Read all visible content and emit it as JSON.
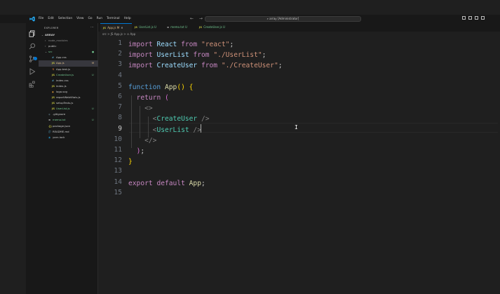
{
  "titlebar": {
    "menu": [
      "File",
      "Edit",
      "Selection",
      "View",
      "Go",
      "Run",
      "Terminal",
      "Help"
    ],
    "nav": "← →",
    "search": "⌕ array [Administrator]"
  },
  "activity": {
    "icons": [
      "explorer-icon",
      "search-icon",
      "source-control-icon",
      "run-debug-icon",
      "extensions-icon"
    ]
  },
  "sidebar": {
    "title": "EXPLORER",
    "more": "···",
    "items": [
      {
        "label": "ARRAY",
        "indent": 0,
        "chev": "⌄",
        "icon": "",
        "color": "#cccccc",
        "mark": "",
        "bold": true
      },
      {
        "label": "node_modules",
        "indent": 1,
        "chev": "›",
        "icon": "",
        "color": "#8b8b8b",
        "mark": ""
      },
      {
        "label": "public",
        "indent": 1,
        "chev": "›",
        "icon": "",
        "color": "#cccccc",
        "mark": ""
      },
      {
        "label": "src",
        "indent": 1,
        "chev": "⌄",
        "icon": "",
        "color": "#73c991",
        "mark": "●"
      },
      {
        "label": "App.css",
        "indent": 2,
        "chev": "",
        "icon": "#",
        "iconColor": "#519aba",
        "color": "#cccccc",
        "mark": ""
      },
      {
        "label": "App.js",
        "indent": 2,
        "chev": "",
        "icon": "JS",
        "iconColor": "#cbcb41",
        "color": "#e2c08d",
        "mark": "M",
        "active": true
      },
      {
        "label": "App.test.js",
        "indent": 2,
        "chev": "",
        "icon": "⚗",
        "iconColor": "#e37933",
        "color": "#cccccc",
        "mark": ""
      },
      {
        "label": "CreateUser.js",
        "indent": 2,
        "chev": "",
        "icon": "JS",
        "iconColor": "#cbcb41",
        "color": "#73c991",
        "mark": "U"
      },
      {
        "label": "index.css",
        "indent": 2,
        "chev": "",
        "icon": "#",
        "iconColor": "#519aba",
        "color": "#cccccc",
        "mark": ""
      },
      {
        "label": "index.js",
        "indent": 2,
        "chev": "",
        "icon": "JS",
        "iconColor": "#cbcb41",
        "color": "#cccccc",
        "mark": ""
      },
      {
        "label": "logo.svg",
        "indent": 2,
        "chev": "",
        "icon": "◈",
        "iconColor": "#ffb13b",
        "color": "#cccccc",
        "mark": ""
      },
      {
        "label": "reportWebVitals.js",
        "indent": 2,
        "chev": "",
        "icon": "JS",
        "iconColor": "#cbcb41",
        "color": "#cccccc",
        "mark": ""
      },
      {
        "label": "setupTests.js",
        "indent": 2,
        "chev": "",
        "icon": "JS",
        "iconColor": "#cbcb41",
        "color": "#cccccc",
        "mark": ""
      },
      {
        "label": "UserList.js",
        "indent": 2,
        "chev": "",
        "icon": "JS",
        "iconColor": "#cbcb41",
        "color": "#73c991",
        "mark": "U"
      },
      {
        "label": ".gitignore",
        "indent": 1,
        "chev": "",
        "icon": "◆",
        "iconColor": "#41535b",
        "color": "#cccccc",
        "mark": ""
      },
      {
        "label": "memo.txt",
        "indent": 1,
        "chev": "",
        "icon": "≡",
        "iconColor": "#cccccc",
        "color": "#73c991",
        "mark": "U"
      },
      {
        "label": "package.json",
        "indent": 1,
        "chev": "",
        "icon": "{}",
        "iconColor": "#cbcb41",
        "color": "#cccccc",
        "mark": ""
      },
      {
        "label": "README.md",
        "indent": 1,
        "chev": "",
        "icon": "ⓘ",
        "iconColor": "#519aba",
        "color": "#cccccc",
        "mark": ""
      },
      {
        "label": "yarn.lock",
        "indent": 1,
        "chev": "",
        "icon": "◉",
        "iconColor": "#2188b6",
        "color": "#cccccc",
        "mark": ""
      }
    ]
  },
  "tabs": [
    {
      "label": "App.js",
      "icon": "JS",
      "status": "M",
      "close": "✕",
      "color": "#e2c08d",
      "active": true
    },
    {
      "label": "UserList.js",
      "icon": "JS",
      "status": "U",
      "close": "",
      "color": "#73c991",
      "active": false
    },
    {
      "label": "memo.txt",
      "icon": "≡",
      "status": "U",
      "close": "",
      "color": "#73c991",
      "active": false
    },
    {
      "label": "CreateUser.js",
      "icon": "JS",
      "status": "U",
      "close": "",
      "color": "#73c991",
      "active": false
    }
  ],
  "breadcrumb": "src > JS App.js > ⊙ App",
  "code": {
    "lines": [
      [
        [
          "k",
          "import"
        ],
        [
          "p",
          " "
        ],
        [
          "v",
          "React"
        ],
        [
          "p",
          " "
        ],
        [
          "k",
          "from"
        ],
        [
          "p",
          " "
        ],
        [
          "s",
          "\"react\""
        ],
        [
          "p",
          ";"
        ]
      ],
      [
        [
          "k",
          "import"
        ],
        [
          "p",
          " "
        ],
        [
          "v",
          "UserList"
        ],
        [
          "p",
          " "
        ],
        [
          "k",
          "from"
        ],
        [
          "p",
          " "
        ],
        [
          "s",
          "\"./UserList\""
        ],
        [
          "p",
          ";"
        ]
      ],
      [
        [
          "k",
          "import"
        ],
        [
          "p",
          " "
        ],
        [
          "v",
          "CreateUser"
        ],
        [
          "p",
          " "
        ],
        [
          "k",
          "from"
        ],
        [
          "p",
          " "
        ],
        [
          "s",
          "\"./CreateUser\""
        ],
        [
          "p",
          ";"
        ]
      ],
      [],
      [
        [
          "kw",
          "function"
        ],
        [
          "p",
          " "
        ],
        [
          "f",
          "App"
        ],
        [
          "b1",
          "()"
        ],
        [
          "p",
          " "
        ],
        [
          "b1",
          "{"
        ]
      ],
      [
        [
          "p",
          "  "
        ],
        [
          "k",
          "return"
        ],
        [
          "p",
          " "
        ],
        [
          "b2",
          "("
        ]
      ],
      [
        [
          "p",
          "    "
        ],
        [
          "pu",
          "<>"
        ]
      ],
      [
        [
          "p",
          "      "
        ],
        [
          "pu",
          "<"
        ],
        [
          "t",
          "CreateUser"
        ],
        [
          "pu",
          " />"
        ]
      ],
      [
        [
          "p",
          "      "
        ],
        [
          "pu",
          "<"
        ],
        [
          "t",
          "UserList"
        ],
        [
          "pu",
          " />"
        ]
      ],
      [
        [
          "p",
          "    "
        ],
        [
          "pu",
          "</>"
        ]
      ],
      [
        [
          "p",
          "  "
        ],
        [
          "b2",
          ")"
        ],
        [
          "p",
          ";"
        ]
      ],
      [
        [
          "b1",
          "}"
        ]
      ],
      [],
      [
        [
          "k",
          "export"
        ],
        [
          "p",
          " "
        ],
        [
          "k",
          "default"
        ],
        [
          "p",
          " "
        ],
        [
          "f",
          "App"
        ],
        [
          "p",
          ";"
        ]
      ],
      []
    ],
    "current_line": 9
  }
}
